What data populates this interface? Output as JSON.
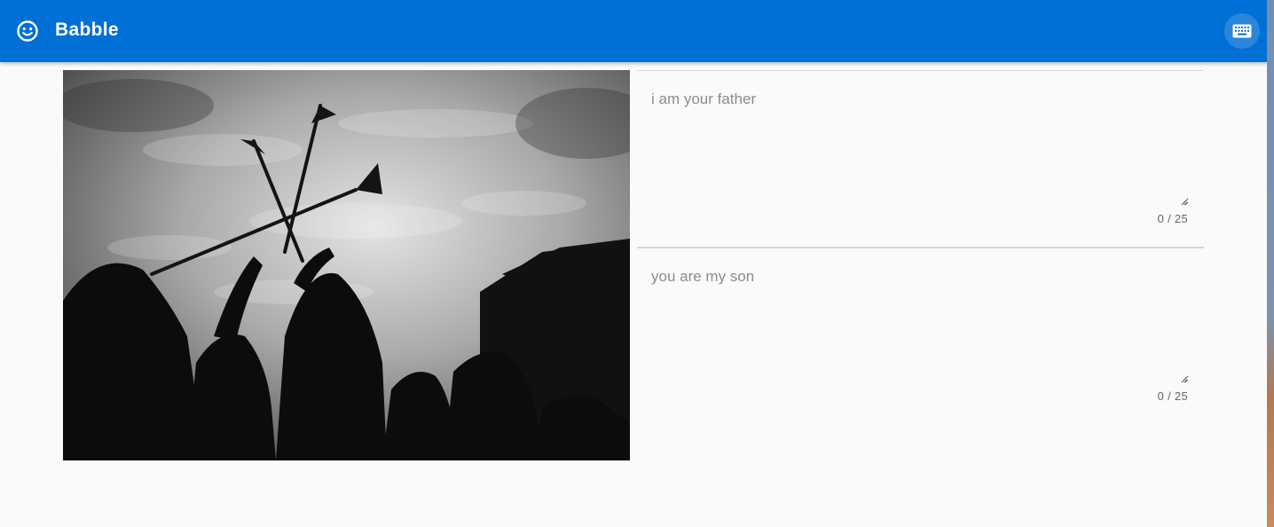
{
  "app": {
    "title": "Babble",
    "logo_icon": "smiley-face-icon",
    "keyboard_icon": "keyboard-icon",
    "accent": "#006fd6"
  },
  "image": {
    "description_icon": "photo"
  },
  "fields": [
    {
      "placeholder": "i am your father",
      "value": "",
      "counter": "0 / 25"
    },
    {
      "placeholder": "you are my son",
      "value": "",
      "counter": "0 / 25"
    }
  ]
}
